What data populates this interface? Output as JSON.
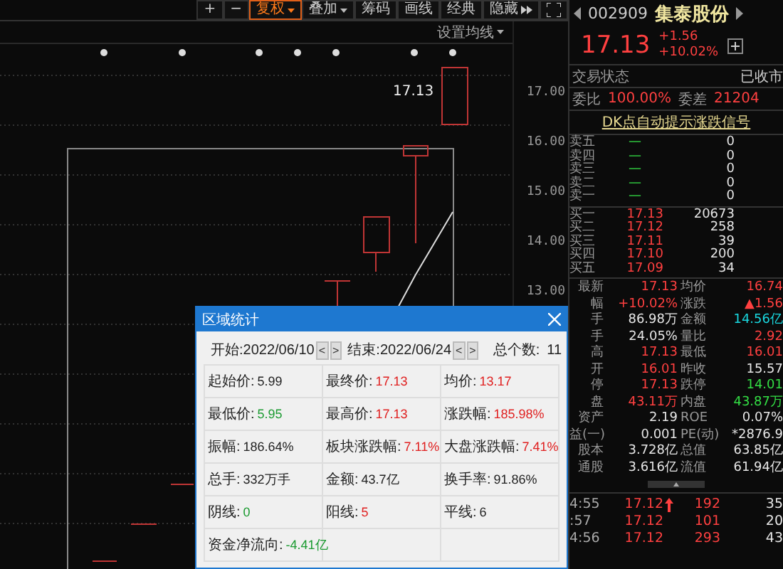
{
  "toolbar": {
    "buttons": [
      {
        "label": "+",
        "kind": "plain",
        "selected": false
      },
      {
        "label": "−",
        "kind": "plain",
        "selected": false
      },
      {
        "label": "复权",
        "kind": "dropdown",
        "selected": true
      },
      {
        "label": "叠加",
        "kind": "dropdown",
        "selected": false
      },
      {
        "label": "筹码",
        "kind": "plain",
        "selected": false
      },
      {
        "label": "画线",
        "kind": "plain",
        "selected": false
      },
      {
        "label": "经典",
        "kind": "plain",
        "selected": false
      },
      {
        "label": "隐藏",
        "kind": "more",
        "selected": false
      }
    ]
  },
  "ma_setting": "设置均线",
  "price_axis": [
    "17.00",
    "16.00",
    "15.00",
    "14.00",
    "13.00"
  ],
  "last_price_tag": "17.13",
  "quote": {
    "code": "002909",
    "name": "集泰股份",
    "price": "17.13",
    "change": "+1.56",
    "change_pct": "+10.02%"
  },
  "status": {
    "label": "交易状态",
    "value": "已收市"
  },
  "ratio": {
    "label": "委比",
    "value": "100.00%",
    "label2": "委差",
    "value2": "21204"
  },
  "signal_link": "DK点自动提示涨跌信号",
  "asks": [
    {
      "label": "卖五",
      "price": "—",
      "volume": "0"
    },
    {
      "label": "卖四",
      "price": "—",
      "volume": "0"
    },
    {
      "label": "卖三",
      "price": "—",
      "volume": "0"
    },
    {
      "label": "卖二",
      "price": "—",
      "volume": "0"
    },
    {
      "label": "卖一",
      "price": "—",
      "volume": "0"
    }
  ],
  "bids": [
    {
      "label": "买一",
      "price": "17.13",
      "volume": "20673"
    },
    {
      "label": "买二",
      "price": "17.12",
      "volume": "258"
    },
    {
      "label": "买三",
      "price": "17.11",
      "volume": "39"
    },
    {
      "label": "买四",
      "price": "17.10",
      "volume": "200"
    },
    {
      "label": "买五",
      "price": "17.09",
      "volume": "34"
    }
  ],
  "stats": [
    {
      "label": "最新",
      "value": "17.13",
      "color": "#ff4040"
    },
    {
      "label": "均价",
      "value": "16.74",
      "color": "#ff4040"
    },
    {
      "label": "幅",
      "value": "+10.02%",
      "color": "#ff4040"
    },
    {
      "label": "涨跌",
      "value": "▲1.56",
      "color": "#ff4040"
    },
    {
      "label": "手",
      "value": "86.98万",
      "color": "#e6e6e6"
    },
    {
      "label": "金额",
      "value": "14.56亿",
      "color": "#19d8e0"
    },
    {
      "label": "手",
      "value": "24.05%",
      "color": "#e6e6e6"
    },
    {
      "label": "量比",
      "value": "2.92",
      "color": "#ff4040"
    },
    {
      "label": "高",
      "value": "17.13",
      "color": "#ff4040"
    },
    {
      "label": "最低",
      "value": "16.01",
      "color": "#ff4040"
    },
    {
      "label": "开",
      "value": "16.01",
      "color": "#ff4040"
    },
    {
      "label": "昨收",
      "value": "15.57",
      "color": "#e6e6e6"
    },
    {
      "label": "停",
      "value": "17.13",
      "color": "#ff4040"
    },
    {
      "label": "跌停",
      "value": "14.01",
      "color": "#33dd44"
    },
    {
      "label": "盘",
      "value": "43.11万",
      "color": "#ff4040"
    },
    {
      "label": "内盘",
      "value": "43.87万",
      "color": "#33dd44"
    },
    {
      "label": "资产",
      "value": "2.19",
      "color": "#e6e6e6"
    },
    {
      "label": "ROE",
      "value": "0.07%",
      "color": "#e6e6e6"
    },
    {
      "label": "益(一)",
      "value": "0.001",
      "color": "#e6e6e6"
    },
    {
      "label": "PE(动)",
      "value": "*2876.9",
      "color": "#e6e6e6"
    },
    {
      "label": "股本",
      "value": "3.728亿",
      "color": "#e6e6e6"
    },
    {
      "label": "总值",
      "value": "63.85亿",
      "color": "#e6e6e6"
    },
    {
      "label": "通股",
      "value": "3.616亿",
      "color": "#e6e6e6"
    },
    {
      "label": "流值",
      "value": "61.94亿",
      "color": "#e6e6e6"
    }
  ],
  "ticks": [
    {
      "time": "4:55",
      "price": "17.12",
      "up": true,
      "volume": "192",
      "count": "35"
    },
    {
      "time": ":57",
      "price": "17.12",
      "up": false,
      "volume": "101",
      "count": "20"
    },
    {
      "time": "4:56",
      "price": "17.12",
      "up": false,
      "volume": "293",
      "count": "43"
    }
  ],
  "dialog": {
    "title": "区域统计",
    "start": "开始:2022/06/10",
    "end": "结束:2022/06/24",
    "count_label": "总个数:",
    "count": "11",
    "nav": [
      "<",
      ">"
    ],
    "cells": [
      {
        "label": "起始价:",
        "value": "5.99",
        "color": "#222222"
      },
      {
        "label": "最终价:",
        "value": "17.13",
        "color": "#e02020"
      },
      {
        "label": "均价:",
        "value": "13.17",
        "color": "#e02020"
      },
      {
        "label": "最低价:",
        "value": "5.95",
        "color": "#1a9a30"
      },
      {
        "label": "最高价:",
        "value": "17.13",
        "color": "#e02020"
      },
      {
        "label": "涨跌幅:",
        "value": "185.98%",
        "color": "#e02020"
      },
      {
        "label": "振幅:",
        "value": "186.64%",
        "color": "#222222"
      },
      {
        "label": "板块涨跌幅:",
        "value": "7.11%",
        "color": "#e02020"
      },
      {
        "label": "大盘涨跌幅:",
        "value": "7.41%",
        "color": "#e02020"
      },
      {
        "label": "总手:",
        "value": "332万手",
        "color": "#222222"
      },
      {
        "label": "金额:",
        "value": "43.7亿",
        "color": "#222222"
      },
      {
        "label": "换手率:",
        "value": "91.86%",
        "color": "#222222"
      },
      {
        "label": "阴线:",
        "value": "0",
        "color": "#1a9a30"
      },
      {
        "label": "阳线:",
        "value": "5",
        "color": "#e02020"
      },
      {
        "label": "平线:",
        "value": "6",
        "color": "#222222"
      },
      {
        "label": "资金净流向:",
        "value": "-4.41亿",
        "color": "#1a9a30"
      }
    ]
  }
}
